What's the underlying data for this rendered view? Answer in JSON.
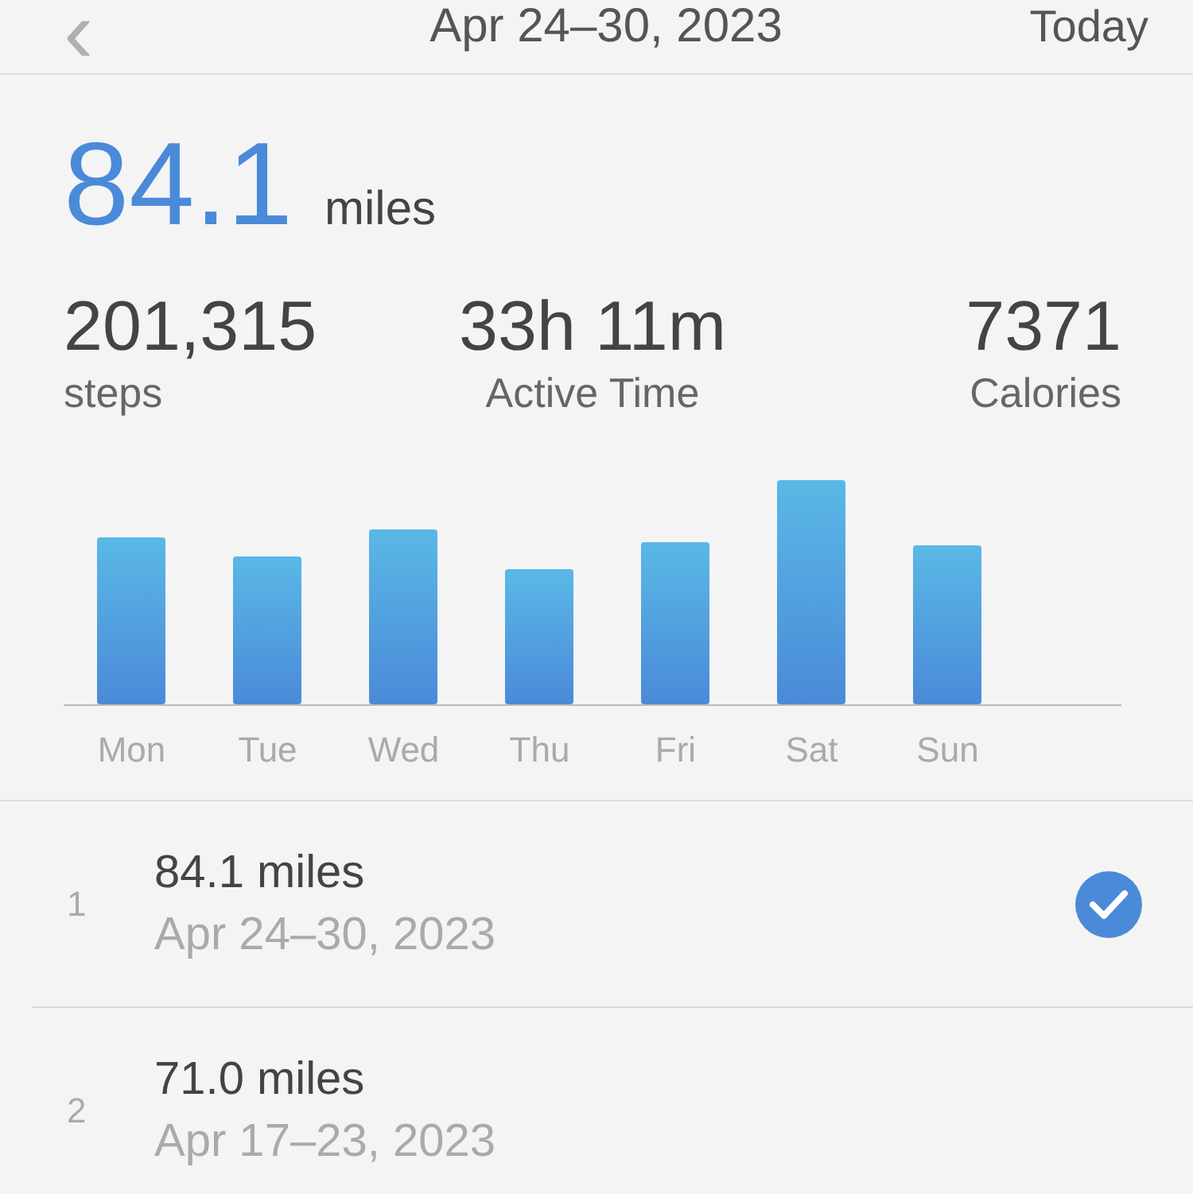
{
  "header": {
    "back": "‹",
    "title": "Apr 24–30, 2023",
    "action": "Today"
  },
  "summary": {
    "distance": "84.1",
    "unit": "miles"
  },
  "stats": [
    {
      "value": "201,315",
      "label": "steps"
    },
    {
      "value": "33h 11m",
      "label": "Active Time"
    },
    {
      "value": "7371",
      "label": "Calories"
    }
  ],
  "chart": {
    "days": [
      "Mon",
      "Tue",
      "Wed",
      "Thu",
      "Fri",
      "Sat",
      "Sun"
    ]
  },
  "weeks": [
    {
      "index": "1",
      "distance": "84.1",
      "unit": "miles",
      "range": "Apr 24–30, 2023",
      "selected": true
    },
    {
      "index": "2",
      "distance": "71.0",
      "unit": "miles",
      "range": "Apr 17–23, 2023",
      "selected": false
    }
  ]
}
